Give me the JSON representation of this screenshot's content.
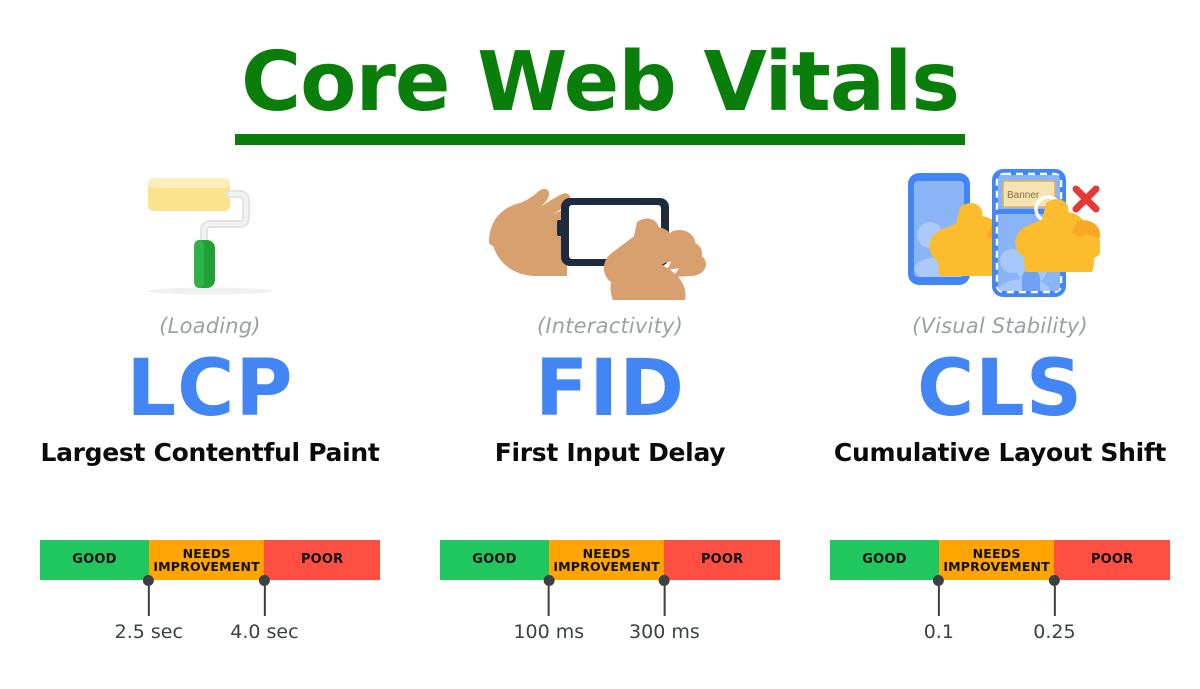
{
  "page": {
    "title": "Core Web Vitals",
    "background_color": "#ffffff",
    "title_color": "#0A7E0A",
    "accent_blue": "#4285F4",
    "subtitle_color": "#9AA0A6"
  },
  "metrics": [
    {
      "icon": "paint-roller-icon",
      "category": "(Loading)",
      "acronym": "LCP",
      "full_name": "Largest Contentful Paint",
      "scale": {
        "segments": [
          {
            "label": "GOOD",
            "color": "#1FC75E"
          },
          {
            "label": "NEEDS IMPROVEMENT",
            "color": "#FFA400"
          },
          {
            "label": "POOR",
            "color": "#FF4E42"
          }
        ],
        "thresholds": [
          "2.5 sec",
          "4.0 sec"
        ]
      }
    },
    {
      "icon": "hand-tapping-phone-icon",
      "category": "(Interactivity)",
      "acronym": "FID",
      "full_name": "First Input Delay",
      "scale": {
        "segments": [
          {
            "label": "GOOD",
            "color": "#1FC75E"
          },
          {
            "label": "NEEDS IMPROVEMENT",
            "color": "#FFA400"
          },
          {
            "label": "POOR",
            "color": "#FF4E42"
          }
        ],
        "thresholds": [
          "100 ms",
          "300 ms"
        ]
      }
    },
    {
      "icon": "layout-shift-phones-icon",
      "category": "(Visual Stability)",
      "acronym": "CLS",
      "full_name": "Cumulative Layout Shift",
      "banner_label": "Banner",
      "scale": {
        "segments": [
          {
            "label": "GOOD",
            "color": "#1FC75E"
          },
          {
            "label": "NEEDS IMPROVEMENT",
            "color": "#FFA400"
          },
          {
            "label": "POOR",
            "color": "#FF4E42"
          }
        ],
        "thresholds": [
          "0.1",
          "0.25"
        ]
      }
    }
  ]
}
